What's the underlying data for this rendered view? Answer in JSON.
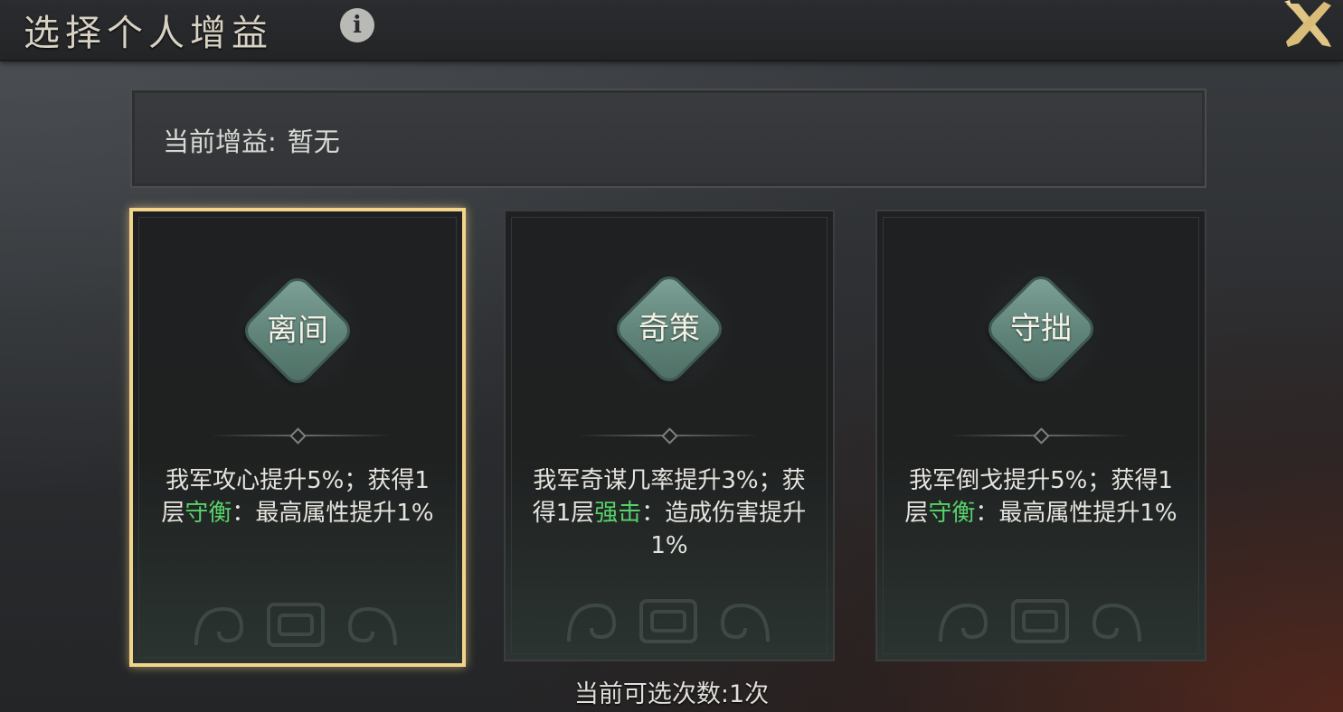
{
  "header": {
    "title": "选择个人增益",
    "info_icon": "info-icon",
    "close_icon": "close-icon"
  },
  "current_buff": {
    "label": "当前增益:",
    "value": "暂无"
  },
  "cards": [
    {
      "emblem": "离间",
      "selected": true,
      "desc_pre": "我军攻心提升5%；获得1层",
      "keyword": "守衡",
      "desc_post": "：最高属性提升1%"
    },
    {
      "emblem": "奇策",
      "selected": false,
      "desc_pre": "我军奇谋几率提升3%；获得1层",
      "keyword": "强击",
      "desc_post": "：造成伤害提升1%"
    },
    {
      "emblem": "守拙",
      "selected": false,
      "desc_pre": "我军倒戈提升5%；获得1层",
      "keyword": "守衡",
      "desc_post": "：最高属性提升1%"
    }
  ],
  "footer": {
    "remaining": "当前可选次数:1次"
  },
  "colors": {
    "selected_border": "#f2d58a",
    "keyword_green": "#57d26a",
    "emblem_jade": "#6a8f84"
  }
}
